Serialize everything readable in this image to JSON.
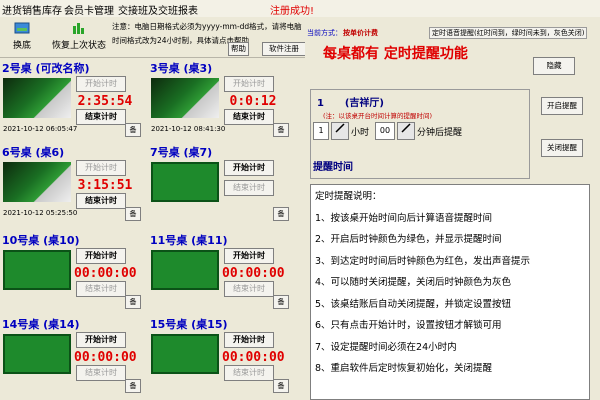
{
  "menu": {
    "items": [
      "进货销售库存",
      "会员卡管理",
      "交接班及交班报表"
    ],
    "registered": "注册成功!"
  },
  "toolbar": {
    "buttons": [
      "换底",
      "恢复上次状态"
    ],
    "notice": "注意：电脑日期格式必须为yyyy-mm-dd格式，请将电脑时间格式改为24小时制，具体请点击帮助",
    "help": "帮助",
    "software_reg": "软件注册"
  },
  "tables": [
    {
      "title": "2号桌 (可改名称)",
      "style": "photo",
      "start": "开始计时",
      "end": "结束计时",
      "clock": "2:35:54",
      "stamp": "2021-10-12 06:05:47",
      "start_disabled": true,
      "end_disabled": false
    },
    {
      "title": "3号桌 (桌3)",
      "style": "photo",
      "start": "开始计时",
      "end": "结束计时",
      "clock": "0:0:12",
      "stamp": "2021-10-12 08:41:30",
      "start_disabled": true,
      "end_disabled": false
    },
    {
      "title": "6号桌 (桌6)",
      "style": "photo",
      "start": "开始计时",
      "end": "结束计时",
      "clock": "3:15:51",
      "stamp": "2021-10-12 05:25:50",
      "start_disabled": true,
      "end_disabled": false
    },
    {
      "title": "7号桌 (桌7)",
      "style": "felt",
      "start": "开始计时",
      "end": "结束计时",
      "clock": "",
      "stamp": "",
      "start_disabled": false,
      "end_disabled": true
    },
    {
      "title": "10号桌 (桌10)",
      "style": "felt",
      "start": "开始计时",
      "end": "结束计时",
      "clock": "00:00:00",
      "stamp": "",
      "start_disabled": false,
      "end_disabled": true
    },
    {
      "title": "11号桌 (桌11)",
      "style": "felt",
      "start": "开始计时",
      "end": "结束计时",
      "clock": "00:00:00",
      "stamp": "",
      "start_disabled": false,
      "end_disabled": true
    },
    {
      "title": "14号桌 (桌14)",
      "style": "felt",
      "start": "开始计时",
      "end": "结束计时",
      "clock": "00:00:00",
      "stamp": "",
      "start_disabled": false,
      "end_disabled": true
    },
    {
      "title": "15号桌 (桌15)",
      "style": "felt",
      "start": "开始计时",
      "end": "结束计时",
      "clock": "00:00:00",
      "stamp": "",
      "start_disabled": false,
      "end_disabled": true
    }
  ],
  "gear_label": "备",
  "right": {
    "mode_label": "当前方式：",
    "mode_value": "按单价计费",
    "tab_label": "定时语音提醒(红时间到，绿时间未到，灰色关闭)",
    "banner": "每桌都有  定时提醒功能",
    "hide_btn": "隐藏",
    "open_btn": "开启提醒",
    "close_btn": "关闭提醒",
    "panel_title": "1      (吉祥厅)",
    "panel_note": "(注：以该桌开台时间计算的提醒时间)",
    "hours_value": "1",
    "hours_label": "小时",
    "minutes_value": "00",
    "minutes_label": "分钟后提醒",
    "remind_time": "提醒时间",
    "desc": [
      "定时提醒说明：",
      "1、按该桌开始时间向后计算语音提醒时间",
      "2、开启后时钟颜色为绿色，并显示提醒时间",
      "3、到达定时时间后时钟颜色为红色，发出声音提示",
      "4、可以随时关闭提醒，关闭后时钟颜色为灰色",
      "5、该桌结账后自动关闭提醒，并锁定设置按钮",
      "6、只有点击开始计时，设置按钮才解锁可用",
      "7、设定提醒时间必须在24小时内",
      "8、重启软件后定时恢复初始化，关闭提醒"
    ]
  }
}
